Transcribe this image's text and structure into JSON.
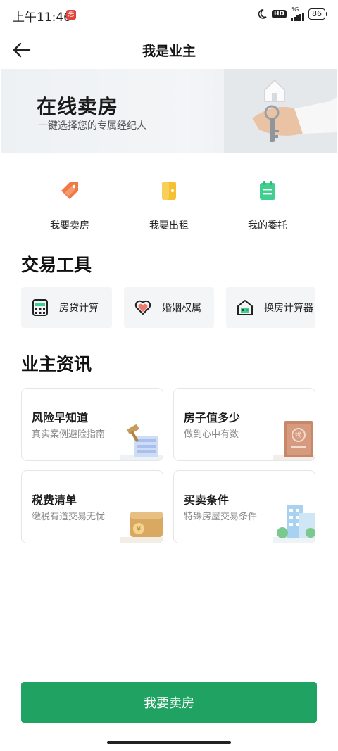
{
  "status_bar": {
    "time": "上午11:46",
    "notification_glyph": "恶",
    "hd": "HD",
    "network": "5G",
    "battery": "86"
  },
  "header": {
    "title": "我是业主",
    "back_icon": "arrow-left-icon"
  },
  "banner": {
    "title": "在线卖房",
    "subtitle": "一键选择您的专属经纪人"
  },
  "quick_actions": [
    {
      "label": "我要卖房",
      "icon": "sell-tag-icon",
      "color": "#f07a46"
    },
    {
      "label": "我要出租",
      "icon": "rent-door-icon",
      "color": "#f5c032"
    },
    {
      "label": "我的委托",
      "icon": "entrust-doc-icon",
      "color": "#3fcf8e"
    }
  ],
  "tools_section": {
    "title": "交易工具",
    "items": [
      {
        "label": "房贷计算",
        "icon": "calculator-icon"
      },
      {
        "label": "婚姻权属",
        "icon": "heart-icon"
      },
      {
        "label": "换房计算器",
        "icon": "house-calculator-icon"
      }
    ]
  },
  "info_section": {
    "title": "业主资讯",
    "cards": [
      {
        "title": "风险早知道",
        "subtitle": "真实案例避险指南",
        "icon": "gavel-icon"
      },
      {
        "title": "房子值多少",
        "subtitle": "做到心中有数",
        "icon": "certificate-book-icon",
        "badge": "换"
      },
      {
        "title": "税费清单",
        "subtitle": "缴税有道交易无忧",
        "icon": "wallet-icon"
      },
      {
        "title": "买卖条件",
        "subtitle": "特殊房屋交易条件",
        "icon": "buildings-icon"
      }
    ]
  },
  "cta": {
    "label": "我要卖房"
  },
  "colors": {
    "accent": "#1fa262",
    "tool_bg": "#f4f5f6"
  }
}
